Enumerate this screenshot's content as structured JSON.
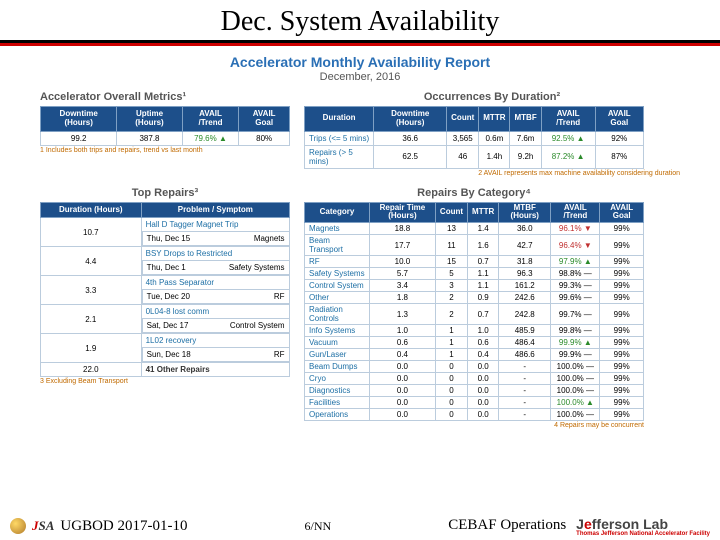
{
  "slide": {
    "title": "Dec. System Availability"
  },
  "report": {
    "title": "Accelerator Monthly Availability Report",
    "subtitle": "December, 2016"
  },
  "overall": {
    "title": "Accelerator Overall Metrics¹",
    "headers": [
      "Downtime\n(Hours)",
      "Uptime\n(Hours)",
      "AVAIL\n/Trend",
      "AVAIL\nGoal"
    ],
    "row": [
      "99.2",
      "387.8",
      "79.6% ▲",
      "80%"
    ],
    "foot": "1 Includes both trips and repairs, trend vs last month"
  },
  "occurrences": {
    "title": "Occurrences By Duration²",
    "headers": [
      "Duration",
      "Downtime\n(Hours)",
      "Count",
      "MTTR",
      "MTBF",
      "AVAIL\n/Trend",
      "AVAIL\nGoal"
    ],
    "rows": [
      [
        "Trips\n(<= 5 mins)",
        "36.6",
        "3,565",
        "0.6m",
        "7.6m",
        "92.5% ▲",
        "92%"
      ],
      [
        "Repairs\n(> 5 mins)",
        "62.5",
        "46",
        "1.4h",
        "9.2h",
        "87.2% ▲",
        "87%"
      ]
    ],
    "foot": "2 AVAIL represents max machine availability considering duration"
  },
  "top": {
    "title": "Top Repairs³",
    "headers": [
      "Duration\n(Hours)",
      "Problem / Symptom"
    ],
    "rows": [
      {
        "d": "10.7",
        "p": "Hall D Tagger Magnet Trip",
        "date": "Thu, Dec 15",
        "cat": "Magnets"
      },
      {
        "d": "4.4",
        "p": "BSY Drops to Restricted",
        "date": "Thu, Dec 1",
        "cat": "Safety Systems"
      },
      {
        "d": "3.3",
        "p": "4th Pass Separator",
        "date": "Tue, Dec 20",
        "cat": "RF"
      },
      {
        "d": "2.1",
        "p": "0L04-8 lost comm",
        "date": "Sat, Dec 17",
        "cat": "Control System"
      },
      {
        "d": "1.9",
        "p": "1L02 recovery",
        "date": "Sun, Dec 18",
        "cat": "RF"
      },
      {
        "d": "22.0",
        "p": "41 Other Repairs",
        "date": "",
        "cat": ""
      }
    ],
    "foot": "3 Excluding Beam Transport"
  },
  "cat": {
    "title": "Repairs By Category⁴",
    "headers": [
      "Category",
      "Repair\nTime\n(Hours)",
      "Count",
      "MTTR",
      "MTBF\n(Hours)",
      "AVAIL\n/Trend",
      "AVAIL\nGoal"
    ],
    "rows": [
      [
        "Magnets",
        "18.8",
        "13",
        "1.4",
        "36.0",
        "96.1% ▼",
        "99%"
      ],
      [
        "Beam Transport",
        "17.7",
        "11",
        "1.6",
        "42.7",
        "96.4% ▼",
        "99%"
      ],
      [
        "RF",
        "10.0",
        "15",
        "0.7",
        "31.8",
        "97.9% ▲",
        "99%"
      ],
      [
        "Safety Systems",
        "5.7",
        "5",
        "1.1",
        "96.3",
        "98.8% —",
        "99%"
      ],
      [
        "Control System",
        "3.4",
        "3",
        "1.1",
        "161.2",
        "99.3% —",
        "99%"
      ],
      [
        "Other",
        "1.8",
        "2",
        "0.9",
        "242.6",
        "99.6% —",
        "99%"
      ],
      [
        "Radiation Controls",
        "1.3",
        "2",
        "0.7",
        "242.8",
        "99.7% —",
        "99%"
      ],
      [
        "Info Systems",
        "1.0",
        "1",
        "1.0",
        "485.9",
        "99.8% —",
        "99%"
      ],
      [
        "Vacuum",
        "0.6",
        "1",
        "0.6",
        "486.4",
        "99.9% ▲",
        "99%"
      ],
      [
        "Gun/Laser",
        "0.4",
        "1",
        "0.4",
        "486.6",
        "99.9% —",
        "99%"
      ],
      [
        "Beam Dumps",
        "0.0",
        "0",
        "0.0",
        "-",
        "100.0% —",
        "99%"
      ],
      [
        "Cryo",
        "0.0",
        "0",
        "0.0",
        "-",
        "100.0% —",
        "99%"
      ],
      [
        "Diagnostics",
        "0.0",
        "0",
        "0.0",
        "-",
        "100.0% —",
        "99%"
      ],
      [
        "Facilities",
        "0.0",
        "0",
        "0.0",
        "-",
        "100.0% ▲",
        "99%"
      ],
      [
        "Operations",
        "0.0",
        "0",
        "0.0",
        "-",
        "100.0% —",
        "99%"
      ]
    ],
    "foot": "4 Repairs may be concurrent"
  },
  "footer": {
    "left": "UGBOD 2017-01-10",
    "page": "6/NN",
    "right": "CEBAF Operations",
    "lab": "Jefferson Lab"
  }
}
